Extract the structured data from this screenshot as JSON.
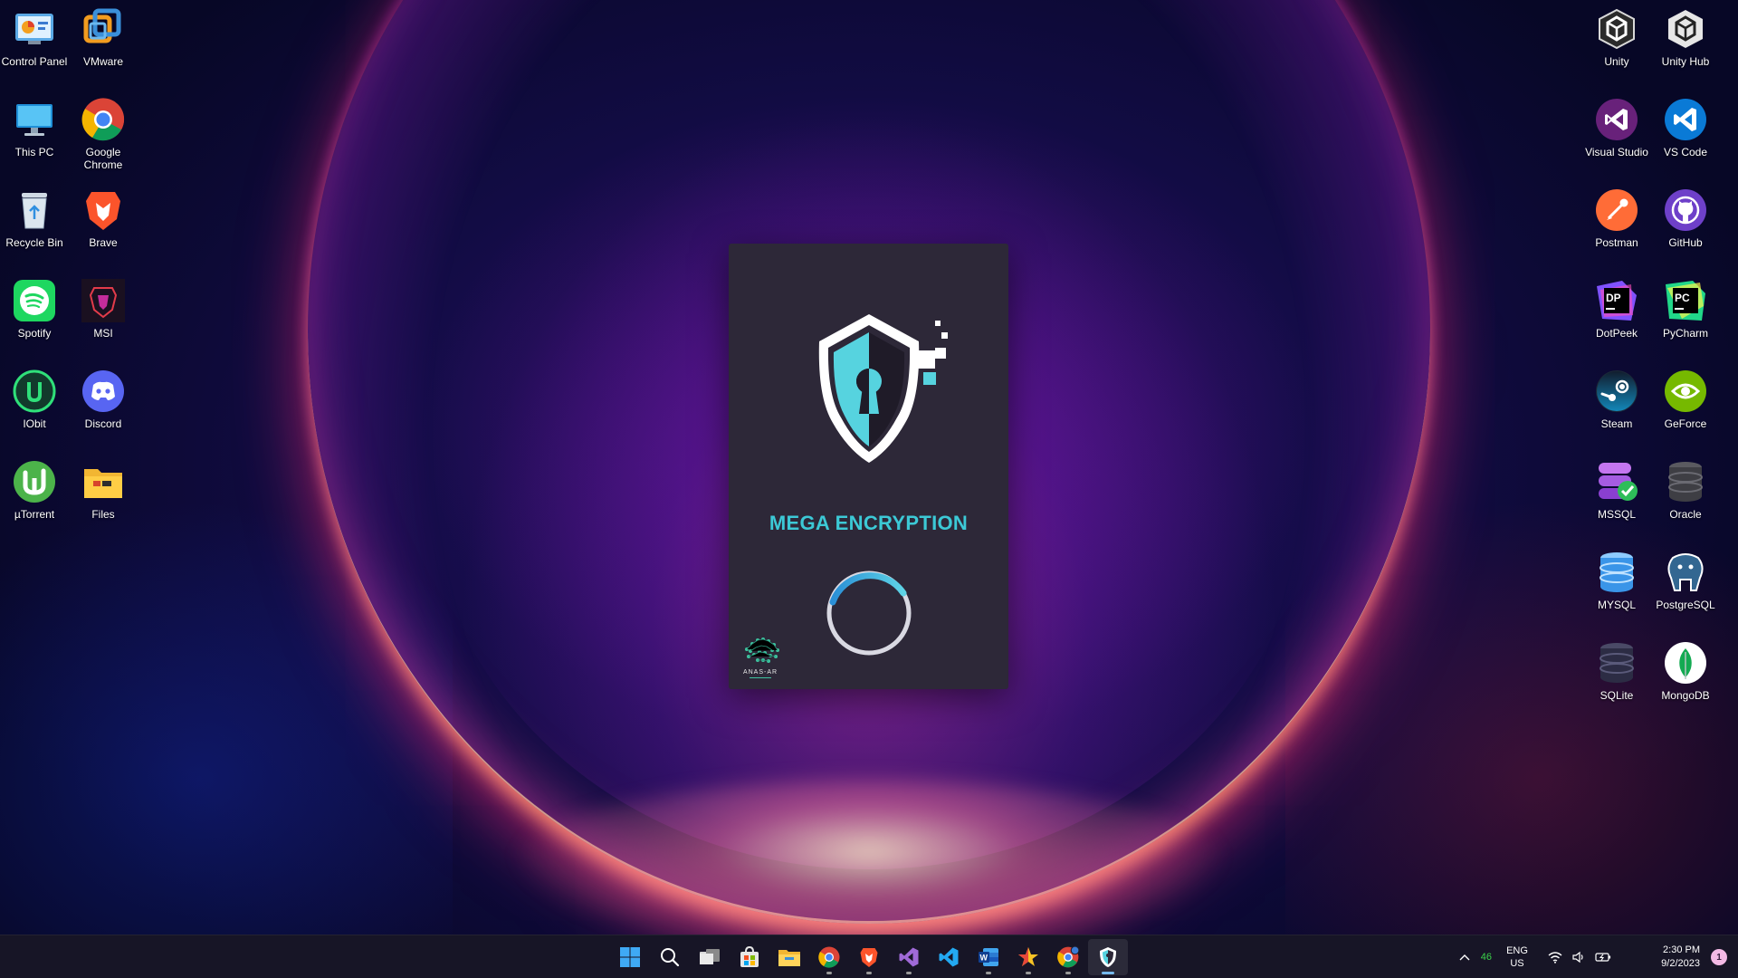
{
  "desktop": {
    "left_icons": [
      {
        "label": "Control Panel",
        "icon": "control-panel-icon"
      },
      {
        "label": "VMware",
        "icon": "vmware-icon"
      },
      {
        "label": "This PC",
        "icon": "this-pc-icon"
      },
      {
        "label": "Google\nChrome",
        "icon": "chrome-icon"
      },
      {
        "label": "Recycle Bin",
        "icon": "recycle-bin-icon"
      },
      {
        "label": "Brave",
        "icon": "brave-icon"
      },
      {
        "label": "Spotify",
        "icon": "spotify-icon"
      },
      {
        "label": "MSI",
        "icon": "msi-icon"
      },
      {
        "label": "IObit",
        "icon": "iobit-icon"
      },
      {
        "label": "Discord",
        "icon": "discord-icon"
      },
      {
        "label": "µTorrent",
        "icon": "utorrent-icon"
      },
      {
        "label": "Files",
        "icon": "files-icon"
      }
    ],
    "right_icons": [
      {
        "label": "Unity",
        "icon": "unity-icon"
      },
      {
        "label": "Unity Hub",
        "icon": "unity-hub-icon"
      },
      {
        "label": "Visual Studio",
        "icon": "visual-studio-icon"
      },
      {
        "label": "VS Code",
        "icon": "vscode-icon"
      },
      {
        "label": "Postman",
        "icon": "postman-icon"
      },
      {
        "label": "GitHub",
        "icon": "github-icon"
      },
      {
        "label": "DotPeek",
        "icon": "dotpeek-icon"
      },
      {
        "label": "PyCharm",
        "icon": "pycharm-icon"
      },
      {
        "label": "Steam",
        "icon": "steam-icon"
      },
      {
        "label": "GeForce",
        "icon": "geforce-icon"
      },
      {
        "label": "MSSQL",
        "icon": "mssql-icon"
      },
      {
        "label": "Oracle",
        "icon": "oracle-icon"
      },
      {
        "label": "MYSQL",
        "icon": "mysql-icon"
      },
      {
        "label": "PostgreSQL",
        "icon": "postgresql-icon"
      },
      {
        "label": "SQLite",
        "icon": "sqlite-icon"
      },
      {
        "label": "MongoDB",
        "icon": "mongodb-icon"
      }
    ]
  },
  "splash": {
    "title": "MEGA ENCRYPTION",
    "brand": "ANAS-AR",
    "accent_color": "#3cc9d6",
    "background_color": "#2d2838"
  },
  "taskbar": {
    "apps": [
      {
        "name": "start-icon",
        "running": false,
        "active": false
      },
      {
        "name": "search-icon",
        "running": false,
        "active": false
      },
      {
        "name": "task-view-icon",
        "running": false,
        "active": false
      },
      {
        "name": "store-icon",
        "running": false,
        "active": false
      },
      {
        "name": "file-explorer-icon",
        "running": false,
        "active": false
      },
      {
        "name": "chrome-icon",
        "running": true,
        "active": false
      },
      {
        "name": "brave-icon",
        "running": true,
        "active": false
      },
      {
        "name": "visual-studio-icon",
        "running": true,
        "active": false
      },
      {
        "name": "vscode-icon",
        "running": false,
        "active": false
      },
      {
        "name": "word-icon",
        "running": true,
        "active": false
      },
      {
        "name": "star-app-icon",
        "running": true,
        "active": false
      },
      {
        "name": "chrome-dev-icon",
        "running": true,
        "active": false
      },
      {
        "name": "mega-encryption-icon",
        "running": true,
        "active": true
      }
    ],
    "tray": {
      "temperature": "46",
      "language_top": "ENG",
      "language_bottom": "US",
      "time": "2:30 PM",
      "date": "9/2/2023",
      "notification_count": "1"
    }
  }
}
